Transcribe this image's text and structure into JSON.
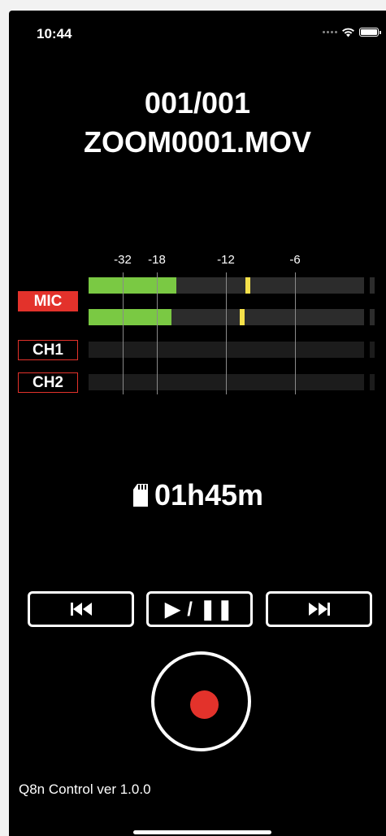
{
  "status_bar": {
    "time": "10:44",
    "signal_icon": "signal-dots-icon",
    "wifi_icon": "wifi-icon",
    "battery_icon": "battery-icon"
  },
  "file": {
    "index": "001/001",
    "name": "ZOOM0001.MOV"
  },
  "meter": {
    "scale_labels": [
      "-32",
      "-18",
      "-12",
      "-6"
    ],
    "channels": [
      {
        "label": "MIC",
        "active": true,
        "levels": [
          0.32,
          0.3
        ],
        "peaks": [
          0.57,
          0.55
        ]
      },
      {
        "label": "CH1",
        "active": false,
        "levels": [
          0
        ],
        "peaks": []
      },
      {
        "label": "CH2",
        "active": false,
        "levels": [
          0
        ],
        "peaks": []
      }
    ],
    "colors": {
      "level": "#7ac943",
      "peak": "#f5e14a",
      "label_red": "#e3322b"
    }
  },
  "remaining": {
    "icon": "sd-card-icon",
    "time": "01h45m"
  },
  "transport": {
    "prev_icon": "skip-back-icon",
    "play_pause_label": "▶ / ❚❚",
    "next_icon": "skip-forward-icon",
    "record_icon": "record-icon"
  },
  "footer": {
    "version": "Q8n Control ver 1.0.0"
  }
}
